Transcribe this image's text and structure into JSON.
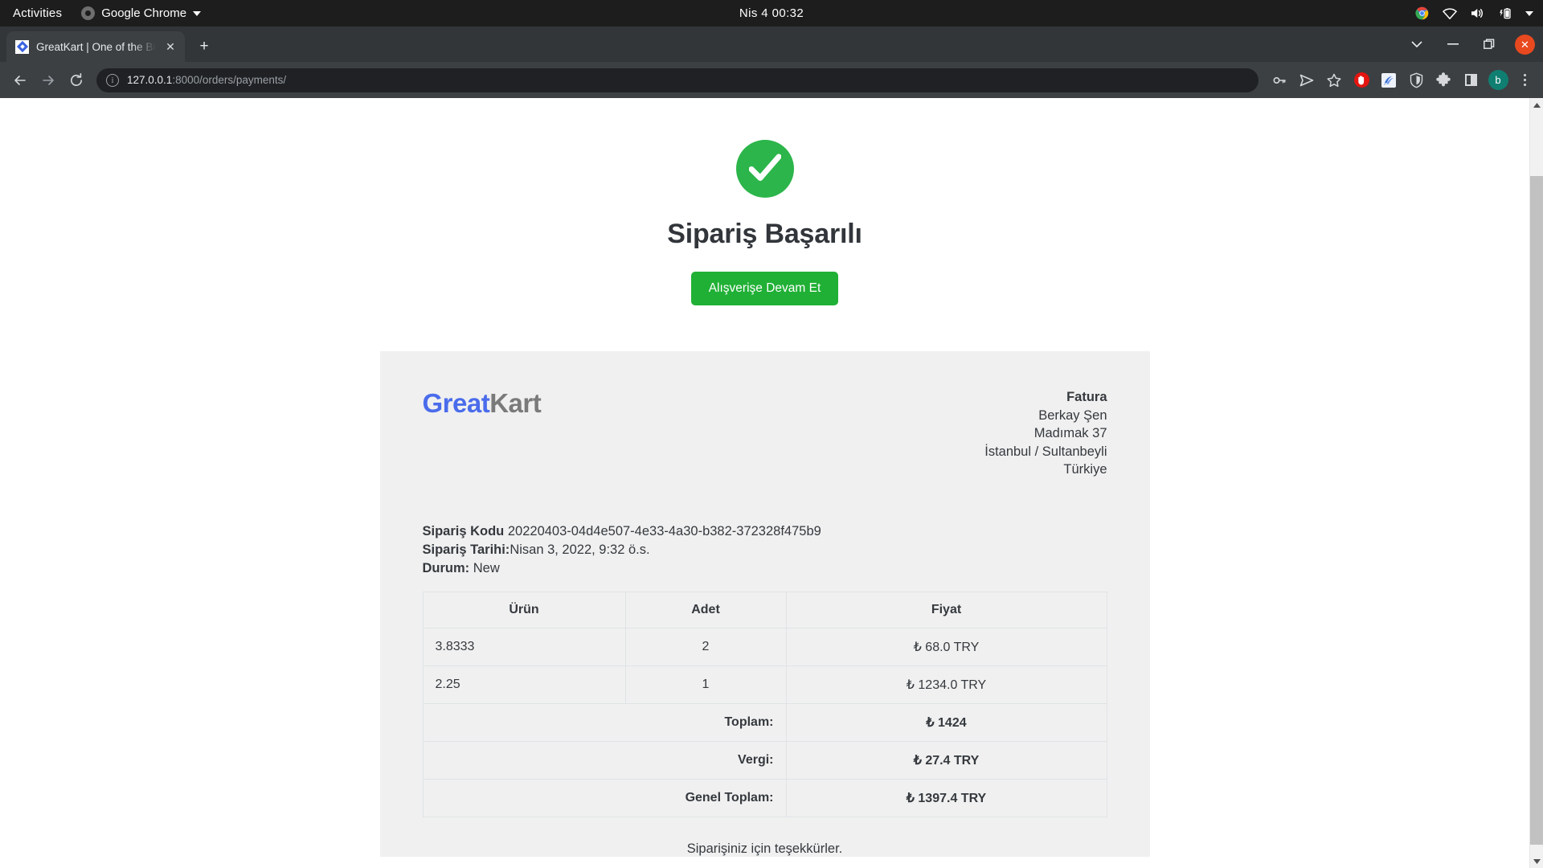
{
  "desktop": {
    "activities_label": "Activities",
    "app_menu_label": "Google Chrome",
    "clock": "Nis 4  00:32",
    "tray_icons": [
      "chrome-icon",
      "wifi-icon",
      "volume-icon",
      "battery-icon",
      "chevron-down-icon"
    ]
  },
  "browser": {
    "tab": {
      "title": "GreatKart | One of the Big",
      "favicon": "greatkart-favicon",
      "close_label": "✕"
    },
    "new_tab_label": "+",
    "window_controls": {
      "tab_search": "tab-search-icon",
      "minimize": "minimize-icon",
      "maximize": "maximize-icon",
      "close": "✕"
    },
    "toolbar": {
      "back": "back-arrow-icon",
      "forward": "forward-arrow-icon",
      "reload": "reload-icon",
      "site_info": "i",
      "url_host": "127.0.0.1",
      "url_path": ":8000/orders/payments/",
      "right_icons": [
        "password-key-icon",
        "share-send-icon",
        "bookmark-star-icon",
        "ublock-origin-icon",
        "extension-blue-icon",
        "zenmate-shield-icon",
        "extensions-puzzle-icon",
        "side-panel-icon"
      ],
      "avatar_letter": "b",
      "menu": "kebab-menu-icon"
    }
  },
  "page": {
    "success_icon": "check-circle-icon",
    "success_title": "Sipariş Başarılı",
    "continue_button": "Alışverişe Devam Et",
    "logo": {
      "part1": "Great",
      "part2": "Kart",
      "color1": "#4a6ceb",
      "color2": "#7a7a7a"
    },
    "billing": {
      "title": "Fatura",
      "name": "Berkay Şen",
      "address": "Madımak 37",
      "city": "İstanbul / Sultanbeyli",
      "country": "Türkiye"
    },
    "order": {
      "code_label": "Sipariş Kodu",
      "code_value": "20220403-04d4e507-4e33-4a30-b382-372328f475b9",
      "date_label": "Sipariş Tarihi:",
      "date_value": "Nisan 3, 2022, 9:32 ö.s.",
      "status_label": "Durum:",
      "status_value": "New"
    },
    "table": {
      "headers": [
        "Ürün",
        "Adet",
        "Fiyat"
      ],
      "rows": [
        {
          "product": "3.8333",
          "qty": "2",
          "price": "₺ 68.0 TRY"
        },
        {
          "product": "2.25",
          "qty": "1",
          "price": "₺ 1234.0 TRY"
        }
      ],
      "summary": [
        {
          "label": "Toplam:",
          "value": "₺ 1424"
        },
        {
          "label": "Vergi:",
          "value": "₺ 27.4 TRY"
        },
        {
          "label": "Genel Toplam:",
          "value": "₺ 1397.4 TRY"
        }
      ]
    },
    "thanks": "Siparişiniz için teşekkürler."
  }
}
